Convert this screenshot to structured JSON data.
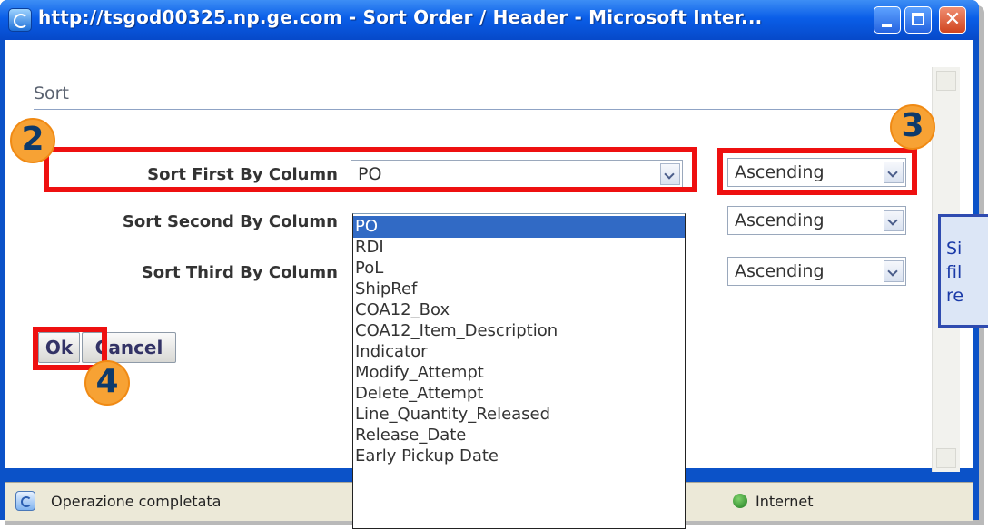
{
  "window": {
    "title": "http://tsgod00325.np.ge.com - Sort Order / Header - Microsoft Inter..."
  },
  "form": {
    "section_title": "Sort",
    "rows": [
      {
        "label": "Sort First By Column",
        "column_value": "PO",
        "order_value": "Ascending"
      },
      {
        "label": "Sort Second By Column",
        "column_value": "",
        "order_value": "Ascending"
      },
      {
        "label": "Sort Third By Column",
        "column_value": "",
        "order_value": "Ascending"
      }
    ],
    "ok_label": "Ok",
    "cancel_label": "Cancel"
  },
  "dropdown": {
    "selected": "PO",
    "options": [
      "PO",
      "RDI",
      "PoL",
      "ShipRef",
      "COA12_Box",
      "COA12_Item_Description",
      "Indicator",
      "Modify_Attempt",
      "Delete_Attempt",
      "Line_Quantity_Released",
      "Release_Date",
      "Early Pickup Date"
    ]
  },
  "status_bar": {
    "text": "Operazione completata",
    "zone": "Internet"
  },
  "annotations": {
    "badges": [
      "2",
      "3",
      "4"
    ],
    "callout_lines": [
      "Si",
      "fil",
      "re"
    ],
    "badge_color": "#f7a234",
    "box_color": "#ee1010"
  }
}
